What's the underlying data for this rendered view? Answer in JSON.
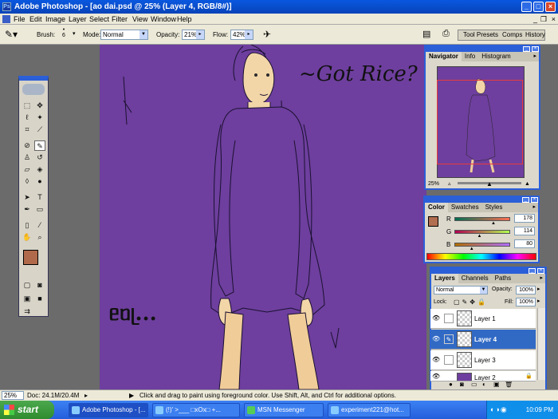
{
  "window": {
    "title": "Adobe Photoshop - [ao dai.psd @ 25% (Layer 4, RGB/8#)]"
  },
  "menu": [
    "File",
    "Edit",
    "Image",
    "Layer",
    "Select",
    "Filter",
    "View",
    "Window",
    "Help"
  ],
  "options": {
    "brush_label": "Brush:",
    "brush_size": "6",
    "mode_label": "Mode:",
    "mode_value": "Normal",
    "opacity_label": "Opacity:",
    "opacity_value": "21%",
    "flow_label": "Flow:",
    "flow_value": "42%"
  },
  "palette_well": [
    "Tool Presets",
    "Comps",
    "History"
  ],
  "canvas": {
    "caption_right": "~Got Rice?",
    "caption_left": "ᥱᥝᥨ...",
    "bg_color": "#6e3f9e"
  },
  "navigator": {
    "tabs": [
      "Navigator",
      "Info",
      "Histogram"
    ],
    "zoom": "25%"
  },
  "color_panel": {
    "tabs": [
      "Color",
      "Swatches",
      "Styles"
    ],
    "channels": [
      {
        "label": "R",
        "value": "178",
        "level": 0.7
      },
      {
        "label": "G",
        "value": "114",
        "level": 0.45
      },
      {
        "label": "B",
        "value": "80",
        "level": 0.31
      }
    ],
    "fg": "#b26e50"
  },
  "layers_panel": {
    "tabs": [
      "Layers",
      "Channels",
      "Paths"
    ],
    "blend_mode": "Normal",
    "opacity_label": "Opacity:",
    "opacity_value": "100%",
    "lock_label": "Lock:",
    "fill_label": "Fill:",
    "fill_value": "100%",
    "layers": [
      {
        "name": "Layer 1",
        "active": false
      },
      {
        "name": "Layer 4",
        "active": true
      },
      {
        "name": "Layer 3",
        "active": false
      },
      {
        "name": "Layer 2",
        "active": false
      }
    ]
  },
  "status": {
    "zoom": "25%",
    "doc": "Doc: 24.1M/20.4M",
    "hint": "Click and drag to paint using foreground color.  Use Shift, Alt, and Ctrl for additional options."
  },
  "taskbar": {
    "start": "start",
    "items": [
      "Adobe Photoshop - [...",
      "(!)' >___ □xOx□ +...",
      "MSN Messenger",
      "experiment221@hot..."
    ],
    "clock": "10:09 PM"
  }
}
